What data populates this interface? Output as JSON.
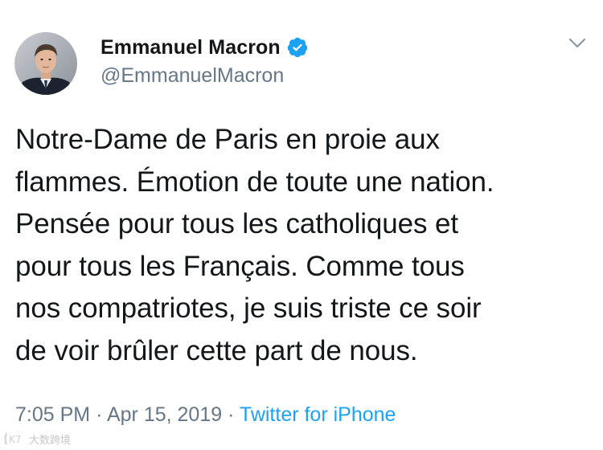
{
  "tweet": {
    "author": {
      "display_name": "Emmanuel Macron",
      "handle": "@EmmanuelMacron",
      "verified": true,
      "avatar_icon": "profile-photo"
    },
    "menu_icon": "chevron-down-icon",
    "text": "Notre-Dame de Paris en proie aux\nflammes. Émotion de toute une nation.\nPensée pour tous les catholiques et\npour tous les Français. Comme tous\nnos compatriotes, je suis triste ce soir\nde voir brûler cette part de nous.",
    "time": "7:05 PM",
    "separator": "·",
    "date": "Apr 15, 2019",
    "source": "Twitter for iPhone"
  },
  "watermark": {
    "logo_text": "K7",
    "text": "大数跨境"
  },
  "colors": {
    "text": "#14171a",
    "secondary": "#657786",
    "accent": "#1da1f2"
  }
}
